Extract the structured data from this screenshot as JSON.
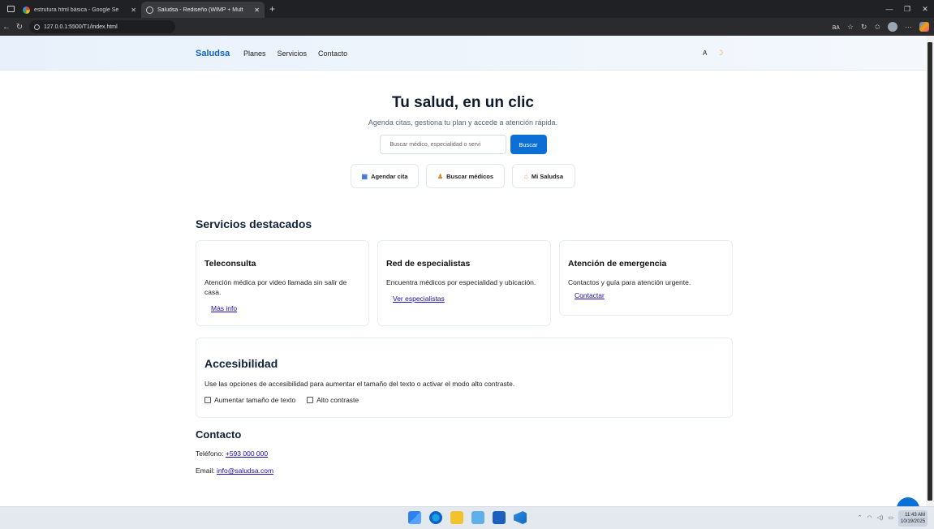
{
  "browser": {
    "tabs": [
      {
        "title": "estrutura html básica - Google Se",
        "active": false
      },
      {
        "title": "Saludsa - Rediseño (WIMP + Mult",
        "active": true
      }
    ],
    "url": "127.0.0.1:5500/T1/index.html"
  },
  "header": {
    "brand": "Saludsa",
    "nav": [
      "Planes",
      "Servicios",
      "Contacto"
    ],
    "font_toggle": "A",
    "theme_icon": "moon-icon"
  },
  "hero": {
    "title": "Tu salud, en un clic",
    "subtitle": "Agenda citas, gestiona tu plan y accede a atención rápida.",
    "search_placeholder": "Buscar médico, especialidad o servi",
    "search_button": "Buscar",
    "quick_actions": [
      {
        "icon": "calendar-icon",
        "label": "Agendar cita"
      },
      {
        "icon": "person-icon",
        "label": "Buscar médicos"
      },
      {
        "icon": "home-icon",
        "label": "Mi Saludsa"
      }
    ]
  },
  "services": {
    "title": "Servicios destacados",
    "cards": [
      {
        "title": "Teleconsulta",
        "text": "Atención médica por video llamada sin salir de casa.",
        "link": "Más info"
      },
      {
        "title": "Red de especialistas",
        "text": "Encuentra médicos por especialidad y ubicación.",
        "link": "Ver especialistas"
      },
      {
        "title": "Atención de emergencia",
        "text": "Contactos y guía para atención urgente.",
        "link": "Contactar"
      }
    ]
  },
  "accessibility": {
    "title": "Accesibilidad",
    "text": "Use las opciones de accesibilidad para aumentar el tamaño del texto o activar el modo alto contraste.",
    "options": [
      {
        "label": "Aumentar tamaño de texto",
        "checked": false
      },
      {
        "label": "Alto contraste",
        "checked": false
      }
    ]
  },
  "contact": {
    "title": "Contacto",
    "phone_label": "Teléfono:",
    "phone": "+593 000 000",
    "email_label": "Email:",
    "email": "info@saludsa.com"
  },
  "taskbar": {
    "time": "11:43 AM",
    "date": "10/19/2025"
  },
  "colors": {
    "accent": "#0b6fd6",
    "brand": "#0b63c7",
    "link": "#1a0dab"
  }
}
